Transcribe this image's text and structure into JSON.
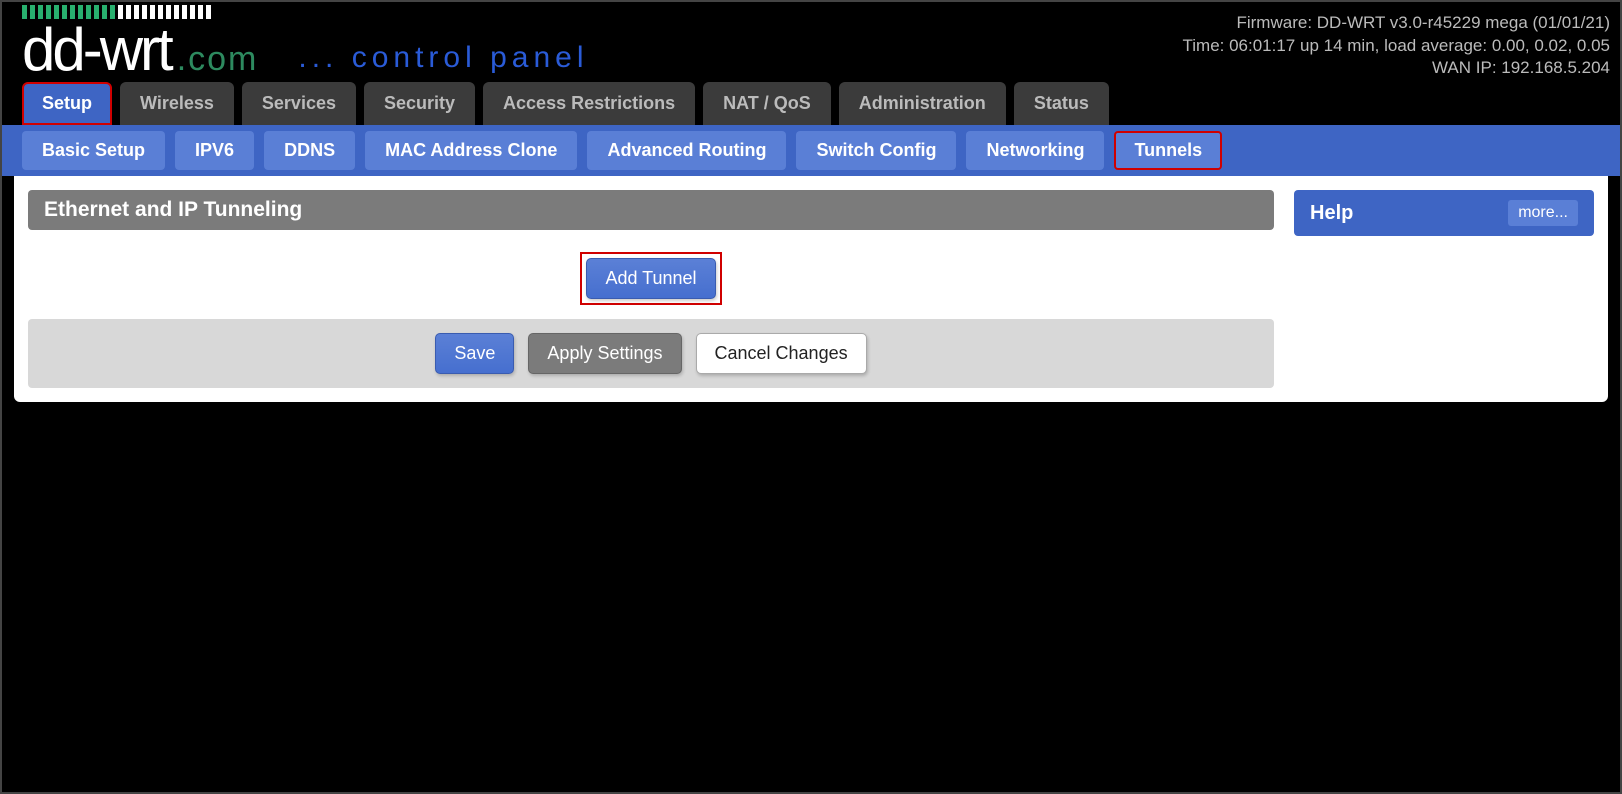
{
  "status": {
    "firmware": "Firmware: DD-WRT v3.0-r45229 mega (01/01/21)",
    "time": "Time: 06:01:17 up 14 min, load average: 0.00, 0.02, 0.05",
    "wan_ip": "WAN IP: 192.168.5.204"
  },
  "logo": {
    "control_panel": "... control panel"
  },
  "main_tabs": {
    "setup": "Setup",
    "wireless": "Wireless",
    "services": "Services",
    "security": "Security",
    "access": "Access Restrictions",
    "natqos": "NAT / QoS",
    "admin": "Administration",
    "status": "Status"
  },
  "sub_tabs": {
    "basic": "Basic Setup",
    "ipv6": "IPV6",
    "ddns": "DDNS",
    "mac": "MAC Address Clone",
    "routing": "Advanced Routing",
    "switch": "Switch Config",
    "networking": "Networking",
    "tunnels": "Tunnels"
  },
  "section": {
    "title": "Ethernet and IP Tunneling",
    "add_tunnel": "Add Tunnel"
  },
  "actions": {
    "save": "Save",
    "apply": "Apply Settings",
    "cancel": "Cancel Changes"
  },
  "help": {
    "title": "Help",
    "more": "more..."
  }
}
